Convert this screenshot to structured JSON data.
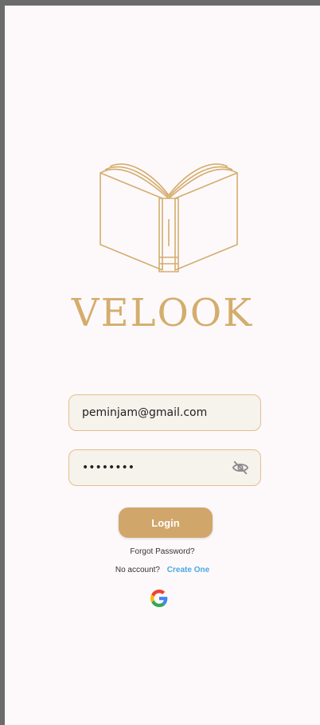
{
  "brand": {
    "name": "VELOOK"
  },
  "form": {
    "email_value": "peminjam@gmail.com",
    "password_value": "••••••••",
    "login_label": "Login",
    "forgot_label": "Forgot Password?",
    "no_account_label": "No account?",
    "create_label": "Create One"
  },
  "colors": {
    "accent": "#d0a66a",
    "link": "#4da8e0",
    "field_bg": "#f6f2ec",
    "background": "#fdf9fb"
  },
  "icons": {
    "logo": "open-book-icon",
    "password_toggle": "eye-off-icon",
    "google": "google-icon"
  }
}
